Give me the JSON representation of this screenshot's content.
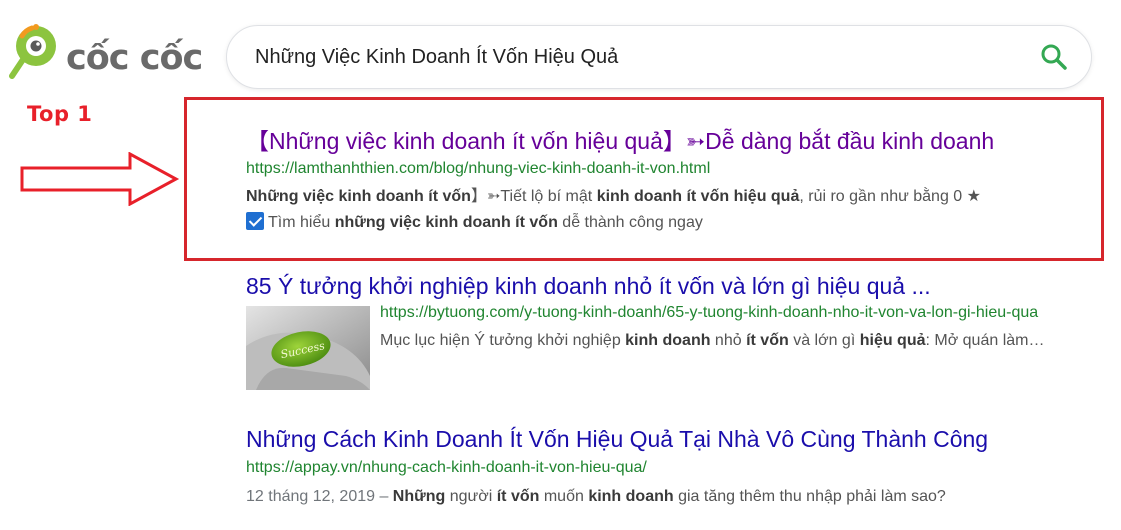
{
  "logo": {
    "text": "cốc cốc",
    "icon": "coccoc-logo-icon"
  },
  "search": {
    "query": "Những Việc Kinh Doanh Ít Vốn Hiệu Quả",
    "icon": "search-icon"
  },
  "annotation": {
    "label": "Top 1",
    "color": "#e8202a"
  },
  "results": [
    {
      "title": "【Những việc kinh doanh ít vốn hiệu quả】➳Dễ dàng bắt đầu kinh doanh",
      "url": "https://lamthanhthien.com/blog/nhung-viec-kinh-doanh-it-von.html",
      "snippet": {
        "b1": "Những việc kinh doanh ít vốn",
        "t1": "】➳Tiết lộ bí mật ",
        "b2": "kinh doanh ít vốn hiệu quả",
        "t2": ", rủi ro gần như bằng 0 ★",
        "t3": "Tìm hiểu ",
        "b3": "những việc kinh doanh ít vốn",
        "t4": " dễ thành công ngay"
      }
    },
    {
      "title": "85 Ý tưởng khởi nghiệp kinh doanh nhỏ ít vốn và lớn gì hiệu quả ...",
      "url": "https://bytuong.com/y-tuong-kinh-doanh/65-y-tuong-kinh-doanh-nho-it-von-va-lon-gi-hieu-qua",
      "thumbnail_text": "Success",
      "snippet": {
        "t1": "Mục lục hiện Ý tưởng khởi nghiệp ",
        "b1": "kinh doanh",
        "t2": " nhỏ ",
        "b2": "ít vốn",
        "t3": " và lớn gì ",
        "b3": "hiệu quả",
        "t4": ": Mở quán làm…"
      }
    },
    {
      "title": "Những Cách Kinh Doanh Ít Vốn Hiệu Quả Tại Nhà Vô Cùng Thành Công",
      "url": "https://appay.vn/nhung-cach-kinh-doanh-it-von-hieu-qua/",
      "snippet": {
        "date": "12 tháng 12, 2019 – ",
        "b1": "Những",
        "t1": " người ",
        "b2": "ít vốn",
        "t2": " muốn ",
        "b3": "kinh doanh",
        "t3": " gia tăng thêm thu nhập phải làm sao?"
      }
    }
  ],
  "colors": {
    "visited_title": "#660099",
    "title": "#1a0dab",
    "url": "#208530",
    "highlight": "#d6262c",
    "logo_green": "#8cc43f",
    "logo_orange": "#f29a1f"
  }
}
